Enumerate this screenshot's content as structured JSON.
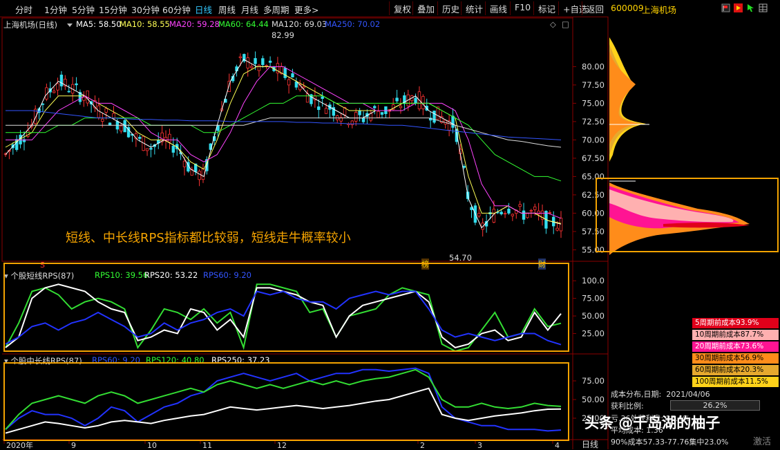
{
  "toolbar": {
    "periods": [
      "分时",
      "1分钟",
      "5分钟",
      "15分钟",
      "30分钟",
      "60分钟",
      "日线",
      "周线",
      "月线",
      "多周期",
      "更多>"
    ],
    "active_period": "日线",
    "buttons": [
      "复权",
      "叠加",
      "历史",
      "统计",
      "画线",
      "F10",
      "标记",
      "+自选",
      "返回"
    ],
    "stock_code": "600009",
    "stock_name": "上海机场"
  },
  "main_pane": {
    "title": "上海机场(日线)",
    "ma_labels": [
      {
        "text": "MA5: 58.50",
        "color": "#ffffff"
      },
      {
        "text": "MA10: 58.55",
        "color": "#ffff55"
      },
      {
        "text": "MA20: 59.28",
        "color": "#ff44ff"
      },
      {
        "text": "MA60: 64.44",
        "color": "#33ff33"
      },
      {
        "text": "MA120: 69.03",
        "color": "#dddddd"
      },
      {
        "text": "MA250: 70.02",
        "color": "#3355ff"
      }
    ],
    "price_ticks": [
      "80.00",
      "77.50",
      "75.00",
      "72.50",
      "70.00",
      "67.50",
      "65.00",
      "62.50",
      "60.00",
      "57.50",
      "55.00"
    ],
    "high_label": "82.99",
    "low_label": "54.70",
    "annotation": "短线、中长线RPS指标都比较弱，短线走牛概率较小",
    "marker_s": "S",
    "marker_mid": "榜",
    "marker_cai": "财"
  },
  "rps_short": {
    "title": "个股短线RPS(87)",
    "labels": [
      {
        "text": "RPS10: 39.56",
        "color": "#33ff33"
      },
      {
        "text": "RPS20: 53.22",
        "color": "#ffffff"
      },
      {
        "text": "RPS60: 9.20",
        "color": "#3355ff"
      }
    ],
    "ticks": [
      "100.0",
      "75.00",
      "50.00",
      "25.00"
    ]
  },
  "rps_long": {
    "title": "个股中长线RPS(87)",
    "labels": [
      {
        "text": "RPS60: 9.20",
        "color": "#3355ff"
      },
      {
        "text": "RPS120: 40.80",
        "color": "#33ff33"
      },
      {
        "text": "RPS250: 37.23",
        "color": "#ffffff"
      }
    ],
    "ticks": [
      "75.00",
      "50.00",
      "25.00"
    ]
  },
  "x_axis": {
    "labels": [
      "2020年",
      "9",
      "10",
      "11",
      "12",
      "2",
      "3",
      "4"
    ],
    "period_label": "日线"
  },
  "cost_legend": [
    {
      "text": "5周期前成本93.9%",
      "color": "#e0001a",
      "fg": "#ffffff"
    },
    {
      "text": "10周期前成本87.7%",
      "color": "#ffb0b0",
      "fg": "#000000"
    },
    {
      "text": "20周期前成本73.6%",
      "color": "#ff1493",
      "fg": "#ffffff"
    },
    {
      "text": "30周期前成本56.9%",
      "color": "#ff8c1a",
      "fg": "#000000"
    },
    {
      "text": "60周期前成本20.3%",
      "color": "#e6a92e",
      "fg": "#000000"
    },
    {
      "text": "100周期前成本11.5%",
      "color": "#ffd21a",
      "fg": "#000000"
    }
  ],
  "cost_info": {
    "title": "成本分布,日期:",
    "date": "2021/04/06",
    "profit_label": "获利比例:",
    "profit_value": "26.2%",
    "row3": "亏.36处获利盘: 27.4%",
    "row4": "平均成本: 1.36",
    "row5": "90%成本57.33-77.76集中23.0%"
  },
  "watermark": "头条 @千岛湖的柚子",
  "activate": "激活",
  "chart_data": [
    {
      "type": "line",
      "title": "上海机场(日线)",
      "ylabel": "price",
      "ylim": [
        54,
        84
      ],
      "series": [
        {
          "name": "MA5",
          "values": [
            68,
            70,
            72,
            76,
            78,
            77,
            76,
            74,
            73,
            72,
            70,
            69,
            70,
            69,
            66,
            65,
            72,
            78,
            81,
            80,
            80,
            79,
            78,
            76,
            75,
            74,
            73,
            73,
            74,
            74,
            75,
            76,
            74,
            73,
            72,
            62,
            58,
            60,
            61,
            60,
            60,
            59,
            58.5
          ]
        },
        {
          "name": "MA10",
          "values": [
            69,
            70,
            71,
            74,
            76,
            76,
            76,
            75,
            74,
            73,
            71,
            70,
            70,
            69,
            67,
            66,
            70,
            75,
            79,
            80,
            80,
            79,
            78,
            77,
            76,
            75,
            74,
            74,
            74,
            74,
            75,
            75,
            75,
            74,
            73,
            65,
            60,
            60,
            61,
            60,
            60,
            59,
            58.6
          ]
        },
        {
          "name": "MA20",
          "values": [
            70,
            70,
            70,
            72,
            74,
            75,
            76,
            75,
            75,
            74,
            73,
            71,
            70,
            70,
            68,
            67,
            68,
            71,
            75,
            78,
            80,
            80,
            79,
            78,
            77,
            76,
            75,
            75,
            74,
            74,
            74,
            75,
            75,
            75,
            74,
            70,
            64,
            61,
            61,
            60,
            60,
            60,
            59.3
          ]
        },
        {
          "name": "MA60",
          "values": [
            71,
            71,
            71,
            71,
            72,
            72,
            73,
            73,
            73,
            73,
            73,
            72,
            72,
            72,
            72,
            71,
            71,
            72,
            73,
            74,
            75,
            75,
            76,
            76,
            76,
            75,
            75,
            75,
            75,
            75,
            75,
            75,
            75,
            74,
            73,
            72,
            70,
            68,
            67,
            66,
            65,
            65,
            64.4
          ]
        },
        {
          "name": "MA120",
          "values": [
            72,
            72,
            72,
            72,
            72,
            72,
            72,
            72,
            72,
            72,
            72,
            72,
            72,
            72,
            72,
            72,
            72,
            72,
            72,
            72.5,
            73,
            73,
            73,
            73,
            73,
            73,
            73,
            73,
            73,
            73,
            73,
            73,
            73,
            72.5,
            72,
            71.5,
            71,
            70.5,
            70,
            69.8,
            69.5,
            69.2,
            69.0
          ]
        },
        {
          "name": "MA250",
          "values": [
            74,
            74,
            74,
            73.8,
            73.6,
            73.4,
            73.2,
            73.0,
            73.0,
            72.9,
            72.8,
            72.8,
            72.7,
            72.7,
            72.6,
            72.6,
            72.6,
            72.5,
            72.5,
            72.5,
            72.5,
            72.5,
            72.4,
            72.4,
            72.3,
            72.3,
            72.2,
            72.2,
            72.1,
            72.0,
            72.0,
            71.8,
            71.6,
            71.4,
            71.2,
            71.0,
            70.8,
            70.6,
            70.4,
            70.3,
            70.2,
            70.1,
            70.0
          ]
        }
      ]
    },
    {
      "type": "line",
      "title": "个股短线RPS(87)",
      "ylim": [
        0,
        110
      ],
      "series": [
        {
          "name": "RPS10",
          "values": [
            5,
            40,
            85,
            90,
            80,
            60,
            70,
            75,
            70,
            60,
            5,
            30,
            60,
            55,
            45,
            60,
            40,
            55,
            5,
            95,
            95,
            90,
            85,
            55,
            60,
            20,
            50,
            55,
            60,
            80,
            90,
            85,
            80,
            10,
            0,
            5,
            30,
            55,
            20,
            25,
            60,
            35,
            39.56
          ]
        },
        {
          "name": "RPS20",
          "values": [
            5,
            20,
            75,
            90,
            95,
            90,
            85,
            70,
            60,
            55,
            15,
            20,
            30,
            25,
            60,
            55,
            30,
            45,
            20,
            90,
            90,
            85,
            80,
            70,
            65,
            20,
            50,
            65,
            70,
            75,
            80,
            85,
            70,
            20,
            5,
            10,
            25,
            30,
            15,
            20,
            55,
            30,
            53.22
          ]
        },
        {
          "name": "RPS60",
          "values": [
            10,
            20,
            35,
            40,
            30,
            40,
            45,
            55,
            45,
            35,
            20,
            25,
            40,
            30,
            40,
            45,
            55,
            60,
            50,
            85,
            80,
            85,
            75,
            70,
            70,
            60,
            75,
            80,
            85,
            80,
            85,
            85,
            60,
            30,
            20,
            25,
            20,
            15,
            20,
            25,
            25,
            15,
            9.2
          ]
        }
      ]
    },
    {
      "type": "line",
      "title": "个股中长线RPS(87)",
      "ylim": [
        0,
        100
      ],
      "series": [
        {
          "name": "RPS60",
          "values": [
            10,
            25,
            35,
            30,
            30,
            25,
            15,
            25,
            40,
            35,
            20,
            30,
            40,
            45,
            55,
            60,
            75,
            80,
            85,
            80,
            75,
            80,
            85,
            75,
            80,
            85,
            85,
            90,
            90,
            88,
            90,
            92,
            85,
            40,
            25,
            20,
            15,
            15,
            10,
            10,
            10,
            8,
            9.2
          ]
        },
        {
          "name": "RPS120",
          "values": [
            10,
            30,
            45,
            50,
            55,
            50,
            45,
            55,
            60,
            55,
            45,
            50,
            55,
            60,
            65,
            60,
            70,
            75,
            70,
            65,
            70,
            65,
            70,
            75,
            70,
            75,
            70,
            75,
            78,
            80,
            85,
            90,
            80,
            50,
            40,
            40,
            45,
            40,
            38,
            40,
            45,
            42,
            40.8
          ]
        },
        {
          "name": "RPS250",
          "values": [
            5,
            10,
            15,
            20,
            18,
            15,
            12,
            15,
            20,
            22,
            20,
            18,
            22,
            25,
            28,
            30,
            35,
            40,
            38,
            36,
            38,
            40,
            42,
            40,
            38,
            40,
            42,
            45,
            48,
            50,
            55,
            60,
            65,
            30,
            25,
            22,
            25,
            28,
            30,
            32,
            35,
            37,
            37.23
          ]
        }
      ]
    }
  ]
}
